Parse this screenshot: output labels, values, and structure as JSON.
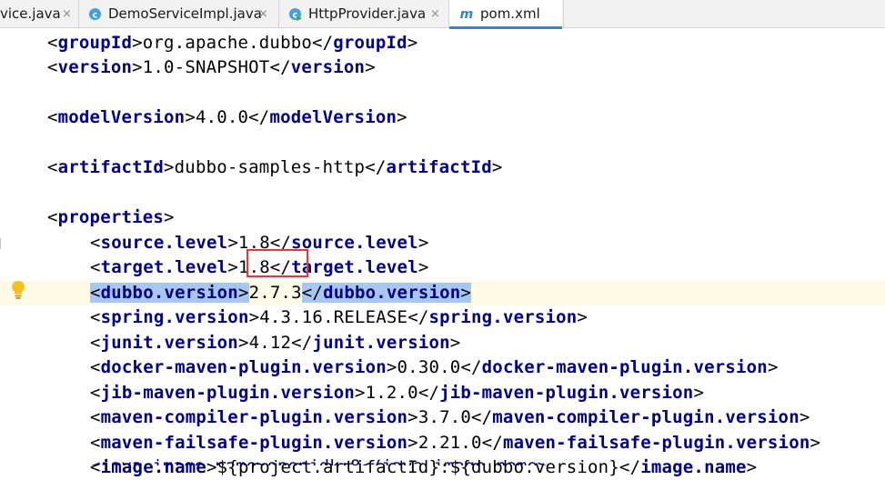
{
  "tabs": [
    {
      "name": "tab-service-java",
      "label": "vice.java",
      "icon": "",
      "active": false
    },
    {
      "name": "tab-demoserviceimpl",
      "label": "DemoServiceImpl.java",
      "icon": "java-class-icon",
      "active": false
    },
    {
      "name": "tab-httpprovider",
      "label": "HttpProvider.java",
      "icon": "java-runnable-class-icon",
      "active": false
    },
    {
      "name": "tab-pom-xml",
      "label": "pom.xml",
      "icon": "maven-icon",
      "active": true
    }
  ],
  "tab_close_glyph": "×",
  "colors": {
    "tag": "#000080",
    "selection": "#a7c7f2",
    "current_row": "#fdfbe6",
    "value_box": "#e23a3a",
    "active_tab_underline": "#4083c9"
  },
  "code_lines": [
    {
      "tag": "groupId",
      "value": "org.apache.dubbo"
    },
    {
      "tag": "version",
      "value": "1.0-SNAPSHOT"
    },
    {
      "blank": true
    },
    {
      "tag": "modelVersion",
      "value": "4.0.0"
    },
    {
      "blank": true
    },
    {
      "tag": "artifactId",
      "value": "dubbo-samples-http"
    },
    {
      "blank": true
    },
    {
      "tag": "properties",
      "value": null
    },
    {
      "tag": "source.level",
      "value": "1.8"
    },
    {
      "tag": "target.level",
      "value": "1.8"
    },
    {
      "tag": "dubbo.version",
      "value": "2.7.3"
    },
    {
      "tag": "spring.version",
      "value": "4.3.16.RELEASE"
    },
    {
      "tag": "junit.version",
      "value": "4.12"
    },
    {
      "tag": "docker-maven-plugin.version",
      "value": "0.30.0"
    },
    {
      "tag": "jib-maven-plugin.version",
      "value": "1.2.0"
    },
    {
      "tag": "maven-compiler-plugin.version",
      "value": "3.7.0"
    },
    {
      "tag": "maven-failsafe-plugin.version",
      "value": "2.21.0"
    },
    {
      "tag": "image.name",
      "value": "${project.artifactId}:${dubbo.version}"
    }
  ],
  "partial_last_line": "<java-image.name>openjdk:8</java-image.name>",
  "gutter": {
    "intention_icon": "lightbulb-icon"
  }
}
